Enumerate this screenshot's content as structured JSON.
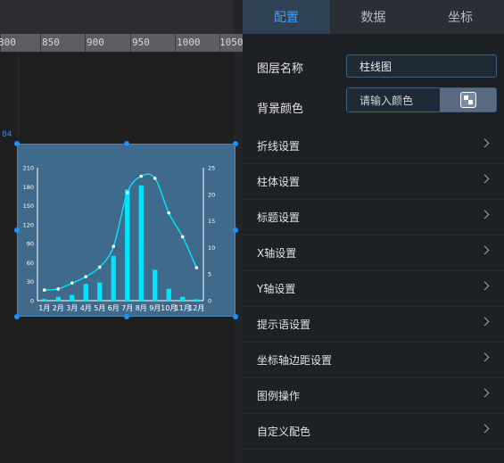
{
  "ruler": {
    "marks": [
      "800",
      "850",
      "900",
      "950",
      "1000",
      "1050"
    ]
  },
  "canvas": {
    "guide_label": "84"
  },
  "panel": {
    "tabs": [
      {
        "label": "配置",
        "active": true
      },
      {
        "label": "数据",
        "active": false
      },
      {
        "label": "坐标",
        "active": false
      }
    ],
    "layer_name_label": "图层名称",
    "layer_name_value": "柱线图",
    "bg_color_label": "背景颜色",
    "bg_color_placeholder": "请输入颜色",
    "settings": [
      "折线设置",
      "柱体设置",
      "标题设置",
      "X轴设置",
      "Y轴设置",
      "提示语设置",
      "坐标轴边距设置",
      "图例操作",
      "自定义配色"
    ]
  },
  "chart_data": {
    "type": "bar",
    "categories": [
      "1月",
      "2月",
      "3月",
      "4月",
      "5月",
      "6月",
      "7月",
      "8月",
      "9月",
      "10月",
      "11月",
      "12月"
    ],
    "series": [
      {
        "type": "bar",
        "axis": "left",
        "values": [
          2.6,
          5.9,
          9,
          26.4,
          28.7,
          70.7,
          175.6,
          182.2,
          48.7,
          18.8,
          6,
          2.3
        ]
      },
      {
        "type": "line",
        "axis": "right",
        "values": [
          2,
          2.2,
          3.3,
          4.5,
          6.3,
          10.2,
          20.3,
          23.4,
          23,
          16.5,
          12,
          6.2
        ]
      }
    ],
    "y_left": {
      "ticks": [
        "0",
        "30",
        "60",
        "90",
        "120",
        "150",
        "180",
        "210"
      ],
      "range": [
        0,
        210
      ]
    },
    "y_right": {
      "ticks": [
        "0",
        "5",
        "10",
        "15",
        "20",
        "25"
      ],
      "range": [
        0,
        25
      ]
    },
    "colors": {
      "bar": "#00e5ff",
      "line": "#00e5ff",
      "axis": "#ffffff"
    }
  }
}
